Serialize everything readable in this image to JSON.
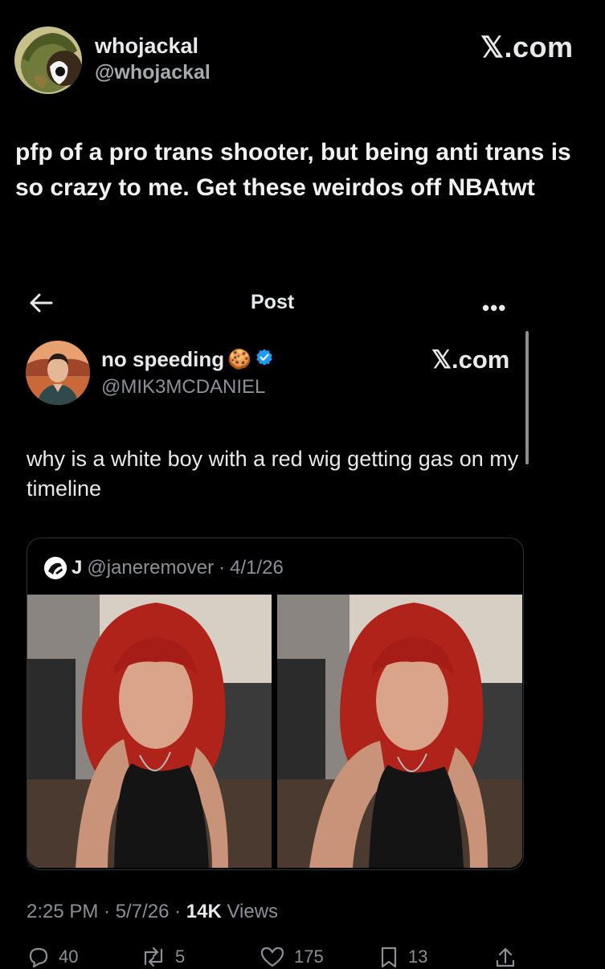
{
  "outer_post": {
    "display_name": "whojackal",
    "handle": "@whojackal",
    "site": "𝕏.com",
    "text": "pfp of a pro trans shooter, but being anti trans is so crazy to me. Get these weirdos off NBAtwt"
  },
  "inner_screenshot": {
    "header_title": "Post",
    "more": "•••",
    "post": {
      "display_name": "no speeding",
      "name_emoji": "🍪",
      "handle": "@MIK3MCDANIEL",
      "site": "𝕏.com",
      "text": "why is a white boy with a red wig getting gas on my timeline",
      "quote": {
        "name": "J",
        "handle": "@janeremover",
        "separator": "·",
        "date": "4/1/26"
      },
      "timestamp": {
        "time_date": "2:25 PM · 5/7/26 · ",
        "views_count": "14K",
        "views_label": " Views"
      },
      "actions": {
        "replies": "40",
        "reposts": "5",
        "likes": "175",
        "bookmarks": "13"
      }
    }
  },
  "colors": {
    "background": "#000000",
    "verified": "#1d9bf0",
    "muted": "#8b9096"
  }
}
